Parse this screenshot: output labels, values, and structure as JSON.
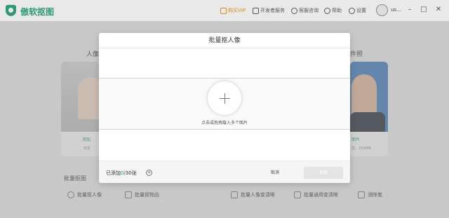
{
  "app": {
    "name": "傲软抠图"
  },
  "titlebar": {
    "vip": "购买VIP",
    "dev": "开发者服务",
    "support": "客服咨询",
    "help": "帮助",
    "settings": "设置",
    "user": "us..."
  },
  "background": {
    "portrait_label": "人像",
    "id_label": "件照",
    "left_card_green": "添加",
    "left_card_small": "仅支",
    "right_card_green": "图片",
    "right_card_small": "式，2XXMB",
    "section_title": "批量抠图",
    "tools": [
      "批量抠人像",
      "批量抠物品",
      "批量人像变清晰",
      "批量通用变清晰",
      "消除笔"
    ]
  },
  "modal": {
    "title": "批量抠人像",
    "drop_hint": "点击或拖拽载入多个图片",
    "count_prefix": "已添加",
    "count_value": "0",
    "count_suffix": "/30张",
    "cancel": "取消",
    "confirm": "抠图"
  },
  "colors": {
    "accent": "#2f9a74",
    "vip": "#d98a1f"
  }
}
